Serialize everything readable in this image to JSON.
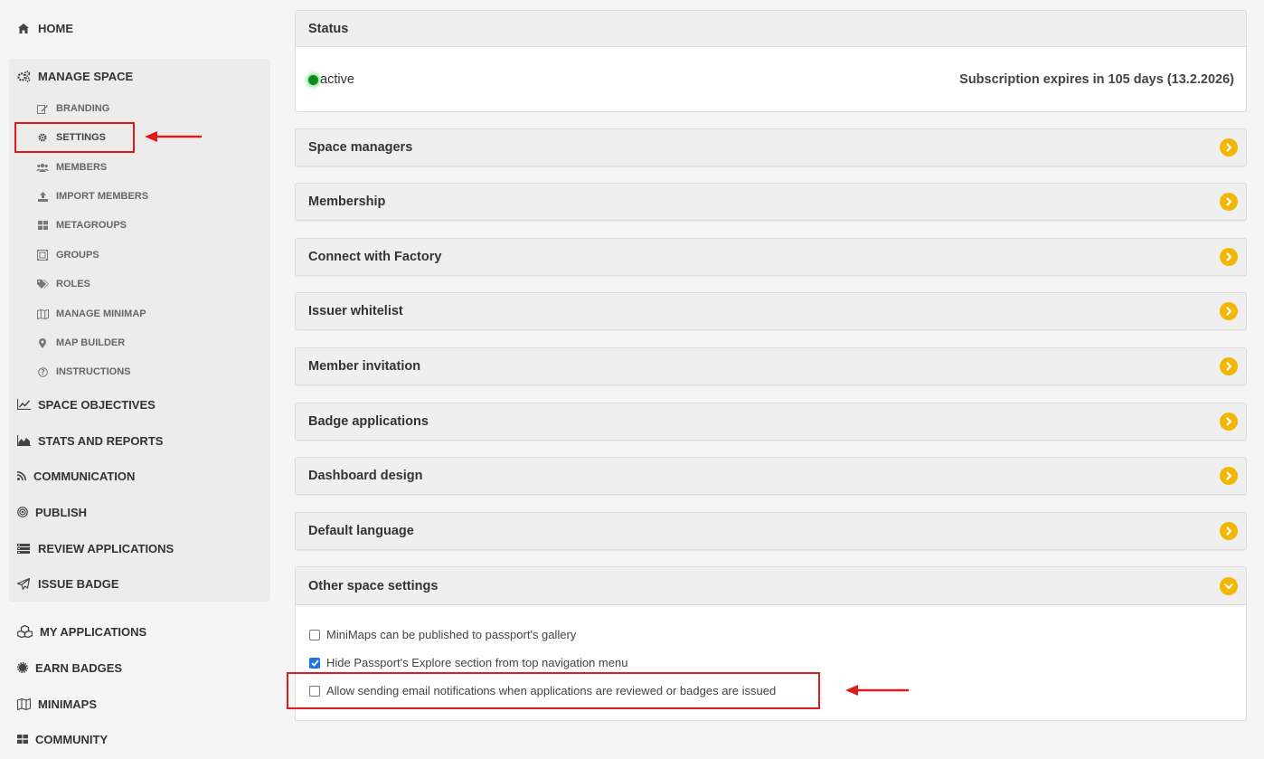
{
  "sidebar": {
    "home": "HOME",
    "manage_space": "MANAGE SPACE",
    "sub_items": [
      {
        "label": "BRANDING",
        "icon": "edit-icon"
      },
      {
        "label": "SETTINGS",
        "icon": "gear-icon"
      },
      {
        "label": "MEMBERS",
        "icon": "users-icon"
      },
      {
        "label": "IMPORT MEMBERS",
        "icon": "upload-icon"
      },
      {
        "label": "METAGROUPS",
        "icon": "grid-icon"
      },
      {
        "label": "GROUPS",
        "icon": "groups-icon"
      },
      {
        "label": "ROLES",
        "icon": "tags-icon"
      },
      {
        "label": "MANAGE MINIMAP",
        "icon": "map-icon"
      },
      {
        "label": "MAP BUILDER",
        "icon": "map-marker-icon"
      },
      {
        "label": "INSTRUCTIONS",
        "icon": "question-icon"
      }
    ],
    "space_objectives": "SPACE OBJECTIVES",
    "stats_and_reports": "STATS AND REPORTS",
    "communication": "COMMUNICATION",
    "publish": "PUBLISH",
    "review_applications": "REVIEW APPLICATIONS",
    "issue_badge": "ISSUE BADGE",
    "my_applications": "MY APPLICATIONS",
    "earn_badges": "EARN BADGES",
    "minimaps": "MINIMAPS",
    "community": "COMMUNITY"
  },
  "status_panel": {
    "title": "Status",
    "state": "active",
    "expiry": "Subscription expires in 105 days (13.2.2026)"
  },
  "sections": [
    "Space managers",
    "Membership",
    "Connect with Factory",
    "Issuer whitelist",
    "Member invitation",
    "Badge applications",
    "Dashboard design",
    "Default language"
  ],
  "other_settings": {
    "title": "Other space settings",
    "options": [
      {
        "label": "MiniMaps can be published to passport's gallery",
        "checked": false
      },
      {
        "label": "Hide Passport's Explore section from top navigation menu",
        "checked": true
      },
      {
        "label": "Allow sending email notifications when applications are reviewed or badges are issued",
        "checked": false
      }
    ]
  },
  "colors": {
    "accent": "#f2b705",
    "highlight": "#e01b1b",
    "checkbox_checked": "#1a73e8",
    "status_dot": "#0e8a1f"
  }
}
